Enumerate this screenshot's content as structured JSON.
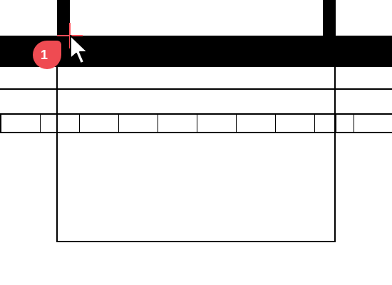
{
  "step_marker": {
    "label": "1"
  },
  "colors": {
    "marker": "#ef4b52",
    "structure": "#000000",
    "background": "#ffffff"
  },
  "icons": {
    "cursor": "mouse-pointer-icon",
    "crosshair": "crosshair-icon"
  }
}
